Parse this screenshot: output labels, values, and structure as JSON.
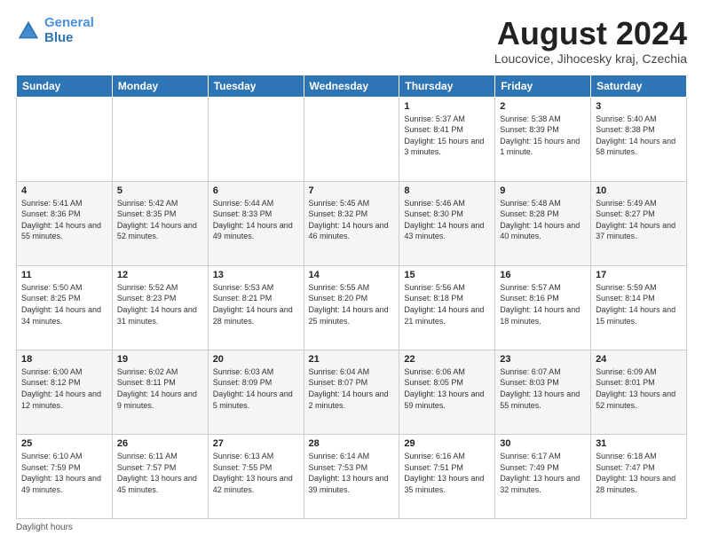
{
  "header": {
    "logo_line1": "General",
    "logo_line2": "Blue",
    "title": "August 2024",
    "subtitle": "Loucovice, Jihocesky kraj, Czechia"
  },
  "days_of_week": [
    "Sunday",
    "Monday",
    "Tuesday",
    "Wednesday",
    "Thursday",
    "Friday",
    "Saturday"
  ],
  "weeks": [
    [
      {
        "day": "",
        "info": ""
      },
      {
        "day": "",
        "info": ""
      },
      {
        "day": "",
        "info": ""
      },
      {
        "day": "",
        "info": ""
      },
      {
        "day": "1",
        "info": "Sunrise: 5:37 AM\nSunset: 8:41 PM\nDaylight: 15 hours\nand 3 minutes."
      },
      {
        "day": "2",
        "info": "Sunrise: 5:38 AM\nSunset: 8:39 PM\nDaylight: 15 hours\nand 1 minute."
      },
      {
        "day": "3",
        "info": "Sunrise: 5:40 AM\nSunset: 8:38 PM\nDaylight: 14 hours\nand 58 minutes."
      }
    ],
    [
      {
        "day": "4",
        "info": "Sunrise: 5:41 AM\nSunset: 8:36 PM\nDaylight: 14 hours\nand 55 minutes."
      },
      {
        "day": "5",
        "info": "Sunrise: 5:42 AM\nSunset: 8:35 PM\nDaylight: 14 hours\nand 52 minutes."
      },
      {
        "day": "6",
        "info": "Sunrise: 5:44 AM\nSunset: 8:33 PM\nDaylight: 14 hours\nand 49 minutes."
      },
      {
        "day": "7",
        "info": "Sunrise: 5:45 AM\nSunset: 8:32 PM\nDaylight: 14 hours\nand 46 minutes."
      },
      {
        "day": "8",
        "info": "Sunrise: 5:46 AM\nSunset: 8:30 PM\nDaylight: 14 hours\nand 43 minutes."
      },
      {
        "day": "9",
        "info": "Sunrise: 5:48 AM\nSunset: 8:28 PM\nDaylight: 14 hours\nand 40 minutes."
      },
      {
        "day": "10",
        "info": "Sunrise: 5:49 AM\nSunset: 8:27 PM\nDaylight: 14 hours\nand 37 minutes."
      }
    ],
    [
      {
        "day": "11",
        "info": "Sunrise: 5:50 AM\nSunset: 8:25 PM\nDaylight: 14 hours\nand 34 minutes."
      },
      {
        "day": "12",
        "info": "Sunrise: 5:52 AM\nSunset: 8:23 PM\nDaylight: 14 hours\nand 31 minutes."
      },
      {
        "day": "13",
        "info": "Sunrise: 5:53 AM\nSunset: 8:21 PM\nDaylight: 14 hours\nand 28 minutes."
      },
      {
        "day": "14",
        "info": "Sunrise: 5:55 AM\nSunset: 8:20 PM\nDaylight: 14 hours\nand 25 minutes."
      },
      {
        "day": "15",
        "info": "Sunrise: 5:56 AM\nSunset: 8:18 PM\nDaylight: 14 hours\nand 21 minutes."
      },
      {
        "day": "16",
        "info": "Sunrise: 5:57 AM\nSunset: 8:16 PM\nDaylight: 14 hours\nand 18 minutes."
      },
      {
        "day": "17",
        "info": "Sunrise: 5:59 AM\nSunset: 8:14 PM\nDaylight: 14 hours\nand 15 minutes."
      }
    ],
    [
      {
        "day": "18",
        "info": "Sunrise: 6:00 AM\nSunset: 8:12 PM\nDaylight: 14 hours\nand 12 minutes."
      },
      {
        "day": "19",
        "info": "Sunrise: 6:02 AM\nSunset: 8:11 PM\nDaylight: 14 hours\nand 9 minutes."
      },
      {
        "day": "20",
        "info": "Sunrise: 6:03 AM\nSunset: 8:09 PM\nDaylight: 14 hours\nand 5 minutes."
      },
      {
        "day": "21",
        "info": "Sunrise: 6:04 AM\nSunset: 8:07 PM\nDaylight: 14 hours\nand 2 minutes."
      },
      {
        "day": "22",
        "info": "Sunrise: 6:06 AM\nSunset: 8:05 PM\nDaylight: 13 hours\nand 59 minutes."
      },
      {
        "day": "23",
        "info": "Sunrise: 6:07 AM\nSunset: 8:03 PM\nDaylight: 13 hours\nand 55 minutes."
      },
      {
        "day": "24",
        "info": "Sunrise: 6:09 AM\nSunset: 8:01 PM\nDaylight: 13 hours\nand 52 minutes."
      }
    ],
    [
      {
        "day": "25",
        "info": "Sunrise: 6:10 AM\nSunset: 7:59 PM\nDaylight: 13 hours\nand 49 minutes."
      },
      {
        "day": "26",
        "info": "Sunrise: 6:11 AM\nSunset: 7:57 PM\nDaylight: 13 hours\nand 45 minutes."
      },
      {
        "day": "27",
        "info": "Sunrise: 6:13 AM\nSunset: 7:55 PM\nDaylight: 13 hours\nand 42 minutes."
      },
      {
        "day": "28",
        "info": "Sunrise: 6:14 AM\nSunset: 7:53 PM\nDaylight: 13 hours\nand 39 minutes."
      },
      {
        "day": "29",
        "info": "Sunrise: 6:16 AM\nSunset: 7:51 PM\nDaylight: 13 hours\nand 35 minutes."
      },
      {
        "day": "30",
        "info": "Sunrise: 6:17 AM\nSunset: 7:49 PM\nDaylight: 13 hours\nand 32 minutes."
      },
      {
        "day": "31",
        "info": "Sunrise: 6:18 AM\nSunset: 7:47 PM\nDaylight: 13 hours\nand 28 minutes."
      }
    ]
  ],
  "footer": {
    "note": "Daylight hours"
  }
}
